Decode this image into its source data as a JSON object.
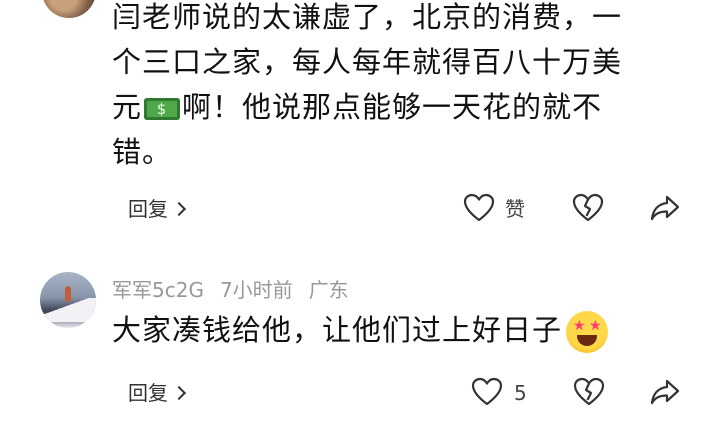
{
  "comments": [
    {
      "text_lines": [
        "闫老师说的太谦虚了，北京的消费，一",
        "个三口之家，每人每年就得百八十万美",
        "元",
        "啊！他说那点能够一天花的就不",
        "错。"
      ],
      "reply_label": "回复",
      "like_label": "赞"
    },
    {
      "username": "军军5c2G",
      "time": "7小时前",
      "location": "广东",
      "text": "大家凑钱给他，让他们过上好日子",
      "reply_label": "回复",
      "like_count": "5"
    }
  ],
  "icons": {
    "money": "dollar-banknote-emoji",
    "star_eyes": "star-struck-emoji",
    "like": "heart-outline-icon",
    "dislike": "broken-heart-icon",
    "share": "share-arrow-icon",
    "chevron": "chevron-right-icon"
  }
}
